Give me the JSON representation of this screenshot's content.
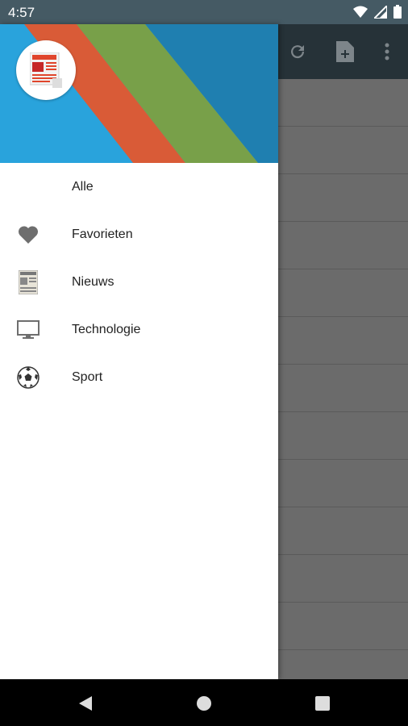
{
  "status_bar": {
    "time": "4:57"
  },
  "app_bar": {
    "actions": [
      {
        "icon": "refresh-icon"
      },
      {
        "icon": "add-document-icon"
      },
      {
        "icon": "more-vert-icon"
      }
    ]
  },
  "drawer": {
    "colors": {
      "header_bg": "#29a3dc",
      "stripe_red": "#d95b37",
      "stripe_green": "#78a049",
      "stripe_dark": "#1f7fb0"
    },
    "items": [
      {
        "label": "Alle",
        "icon": "none"
      },
      {
        "label": "Favorieten",
        "icon": "heart-icon"
      },
      {
        "label": "Nieuws",
        "icon": "newspaper-icon"
      },
      {
        "label": "Technologie",
        "icon": "monitor-icon"
      },
      {
        "label": "Sport",
        "icon": "soccer-ball-icon"
      }
    ]
  }
}
